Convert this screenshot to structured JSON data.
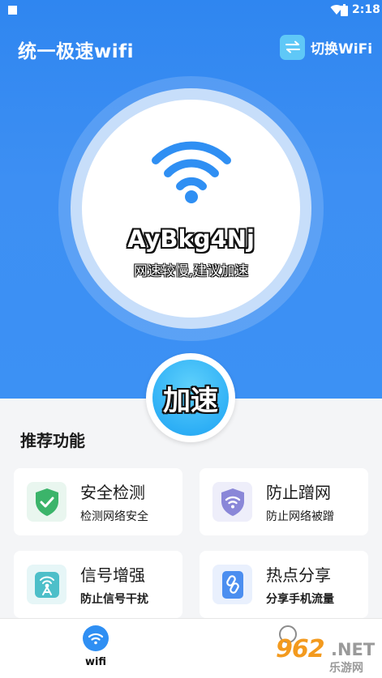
{
  "status_bar": {
    "time": "2:18"
  },
  "header": {
    "title": "统一极速wifi",
    "switch_label": "切换WiFi"
  },
  "network": {
    "name": "AyBkg4Nj",
    "hint": "网速较慢,建议加速"
  },
  "speed_button": {
    "label": "加速"
  },
  "recommended": {
    "title": "推荐功能",
    "cards": [
      {
        "title": "安全检测",
        "subtitle": "检测网络安全",
        "icon": "shield-check-icon"
      },
      {
        "title": "防止蹭网",
        "subtitle": "防止网络被蹭",
        "icon": "shield-wifi-icon"
      },
      {
        "title": "信号增强",
        "subtitle": "防止信号干扰",
        "icon": "signal-tower-icon"
      },
      {
        "title": "热点分享",
        "subtitle": "分享手机流量",
        "icon": "link-icon"
      }
    ]
  },
  "bottom_nav": {
    "items": [
      {
        "label": "wifi",
        "icon": "wifi-icon",
        "active": true
      },
      {
        "label": "",
        "icon": "profile-icon",
        "active": false
      }
    ]
  },
  "watermark": {
    "number": "962",
    "domain": ".NET",
    "cn": "乐游网"
  },
  "colors": {
    "primary_blue": "#3c91f4",
    "accent_cyan": "#2fb0f6",
    "shield_green": "#3bb46a",
    "shield_purple": "#8a87d8",
    "signal_teal": "#4dbfc9",
    "link_blue": "#4b8ef0"
  }
}
